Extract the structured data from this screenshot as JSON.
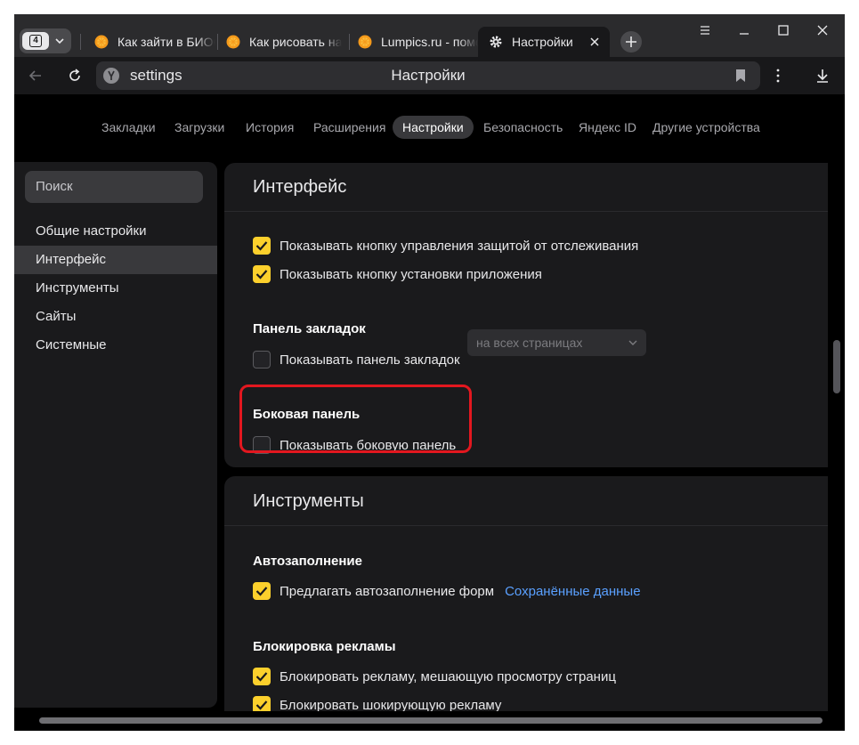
{
  "tabstrip": {
    "tab_count": "4",
    "tabs": [
      {
        "title": "Как зайти в БИОС"
      },
      {
        "title": "Как рисовать на"
      },
      {
        "title": "Lumpics.ru - помо"
      },
      {
        "title": "Настройки"
      }
    ]
  },
  "toolbar": {
    "url": "settings",
    "page_title": "Настройки"
  },
  "nav": {
    "items": [
      "Закладки",
      "Загрузки",
      "История",
      "Расширения",
      "Настройки",
      "Безопасность",
      "Яндекс ID",
      "Другие устройства"
    ]
  },
  "sidebar": {
    "search_placeholder": "Поиск",
    "items": [
      "Общие настройки",
      "Интерфейс",
      "Инструменты",
      "Сайты",
      "Системные"
    ]
  },
  "interface": {
    "title": "Интерфейс",
    "opt_tracking": "Показывать кнопку управления защитой от отслеживания",
    "opt_install": "Показывать кнопку установки приложения",
    "bookmarks_title": "Панель закладок",
    "opt_bookmarks": "Показывать панель закладок",
    "bookmarks_select": "на всех страницах",
    "sidepanel_title": "Боковая панель",
    "opt_sidepanel": "Показывать боковую панель"
  },
  "tools": {
    "title": "Инструменты",
    "autofill_title": "Автозаполнение",
    "opt_autofill": "Предлагать автозаполнение форм",
    "autofill_link": "Сохранённые данные",
    "adblock_title": "Блокировка рекламы",
    "opt_adblock1": "Блокировать рекламу, мешающую просмотру страниц",
    "opt_adblock2": "Блокировать шокирующую рекламу"
  },
  "colors": {
    "accent": "#fcd02c",
    "link": "#5aa0ff",
    "highlight": "#e3171f"
  }
}
